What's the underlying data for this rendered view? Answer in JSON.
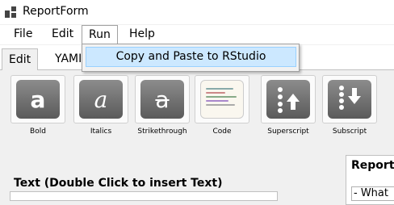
{
  "window": {
    "title": "ReportForm"
  },
  "menubar": {
    "file": "File",
    "edit": "Edit",
    "run": "Run",
    "help": "Help"
  },
  "run_menu": {
    "items": [
      "Copy and Paste to RStudio"
    ]
  },
  "tabs": [
    {
      "label": "Edit"
    },
    {
      "label": "YAMI"
    }
  ],
  "toolbar": {
    "buttons": [
      {
        "label": "Bold",
        "icon": "bold-a-icon"
      },
      {
        "label": "Italics",
        "icon": "italic-a-icon"
      },
      {
        "label": "Strikethrough",
        "icon": "strikethrough-a-icon"
      },
      {
        "label": "Code",
        "icon": "code-icon"
      },
      {
        "label": "Superscript",
        "icon": "superscript-icon"
      },
      {
        "label": "Subscript",
        "icon": "subscript-icon"
      }
    ],
    "glyph_a": "a"
  },
  "text_panel": {
    "label": "Text (Double Click to insert Text)"
  },
  "report_panel": {
    "title": "Report",
    "items": [
      "- What"
    ]
  },
  "colors": {
    "menu_highlight": "#cce8ff",
    "icon_gray": "#6b6b6b"
  }
}
